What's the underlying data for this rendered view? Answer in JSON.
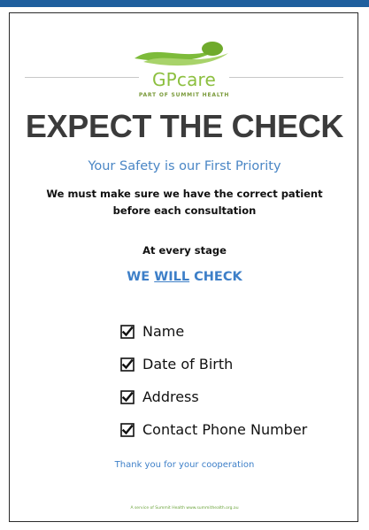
{
  "logo": {
    "name": "GPcare",
    "tagline": "PART OF SUMMIT HEALTH"
  },
  "heading": "EXPECT THE CHECK",
  "subheading": "Your Safety is our First Priority",
  "intro": {
    "line1": "We must make sure we have the correct patient",
    "line2": "before each consultation"
  },
  "stage": "At every stage",
  "will_check": {
    "before": "WE ",
    "underlined": "WILL",
    "after": " CHECK"
  },
  "checklist": [
    "Name",
    "Date of Birth",
    "Address",
    "Contact Phone Number"
  ],
  "thanks": "Thank you for your cooperation",
  "footer": "A service of Summit Health www.summithealth.org.au",
  "colors": {
    "header_bar": "#1f5f9e",
    "logo_green": "#8cbf3f",
    "heading": "#3b3b3b",
    "accent_blue": "#3d7fc8"
  }
}
